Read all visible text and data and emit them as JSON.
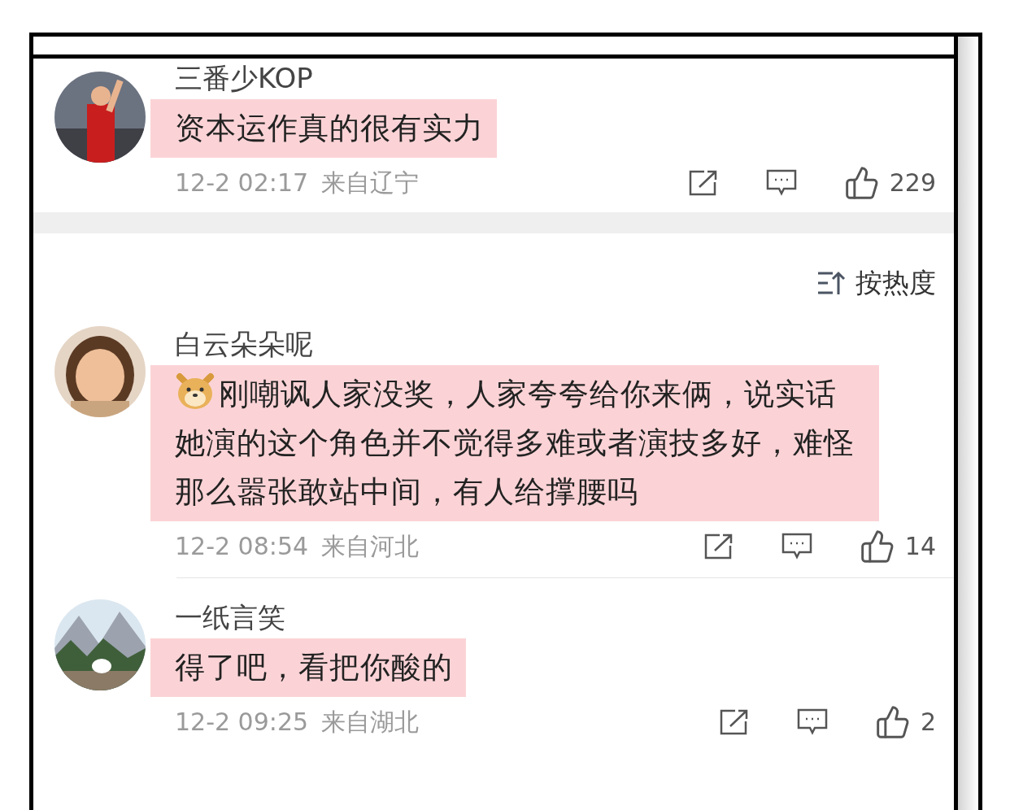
{
  "first_comment": {
    "user": "三番少KOP",
    "text": "资本运作真的很有实力",
    "time": "12-2 02:17",
    "location": "来自辽宁",
    "likes": "229",
    "leading_emoji": false
  },
  "sort": {
    "label": "按热度"
  },
  "comments": [
    {
      "user": "白云朵朵呢",
      "text": "刚嘲讽人家没奖，人家夸夸给你来俩，说实话她演的这个角色并不觉得多难或者演技多好，难怪那么嚣张敢站中间，有人给撑腰吗",
      "time": "12-2 08:54",
      "location": "来自河北",
      "likes": "14",
      "leading_emoji": true
    },
    {
      "user": "一纸言笑",
      "text": "得了吧，看把你酸的",
      "time": "12-2 09:25",
      "location": "来自湖北",
      "likes": "2",
      "leading_emoji": false
    }
  ]
}
